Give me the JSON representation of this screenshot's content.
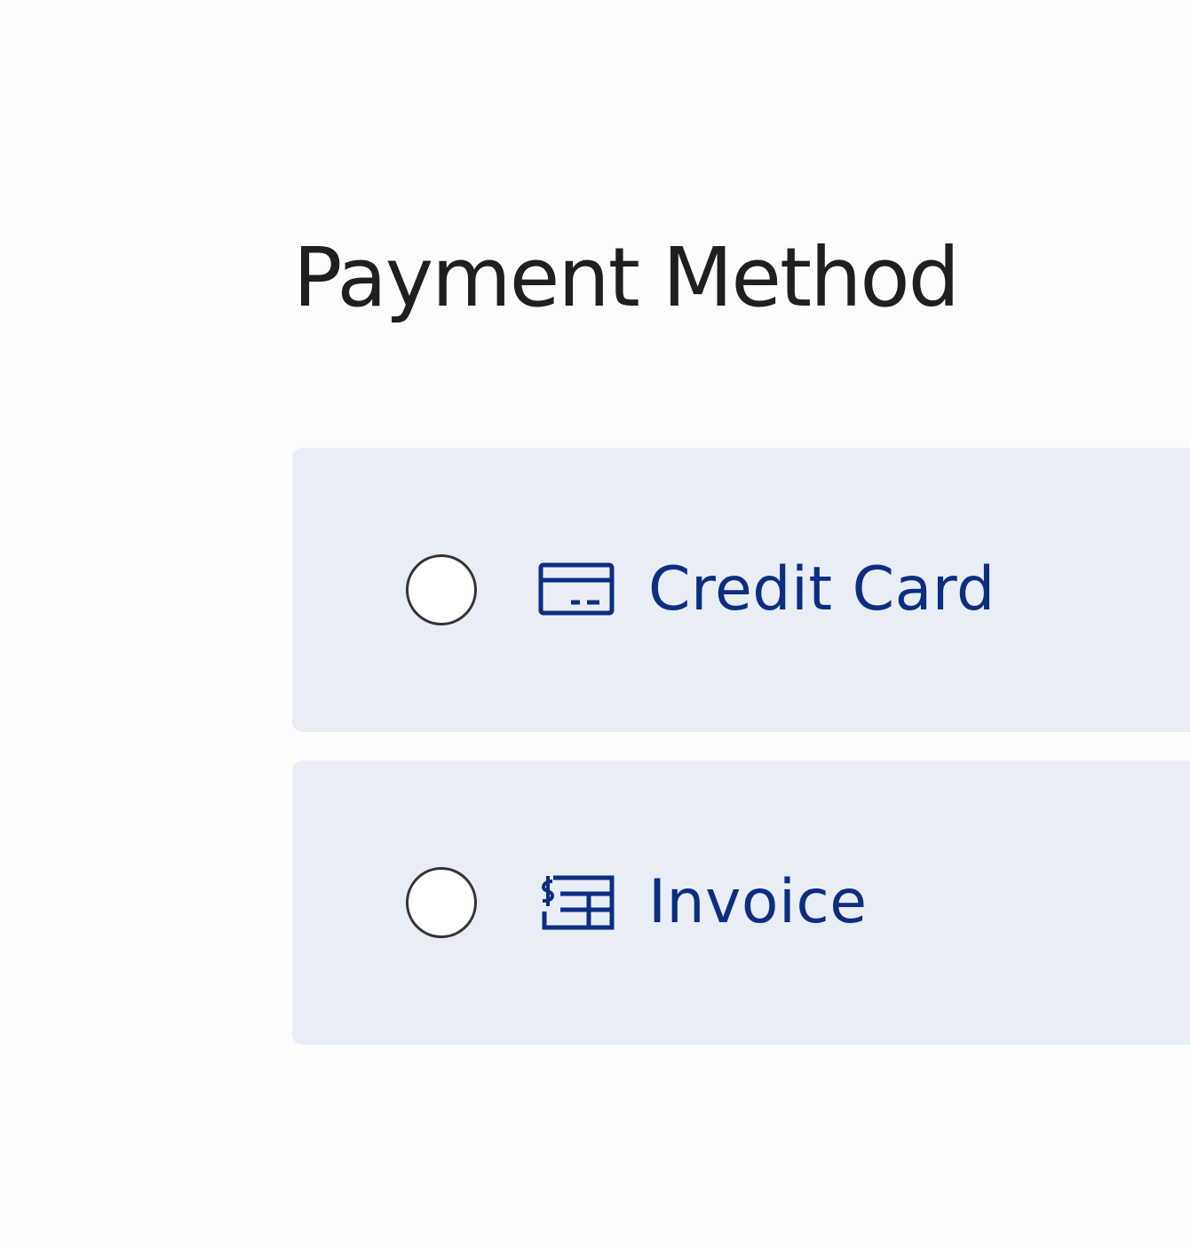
{
  "page": {
    "title": "Payment Method"
  },
  "payment_options": [
    {
      "label": "Credit Card",
      "icon": "credit-card-icon",
      "selected": false
    },
    {
      "label": "Invoice",
      "icon": "invoice-icon",
      "selected": false
    }
  ],
  "colors": {
    "accent": "#0b2e82",
    "option_background": "#e9eef6",
    "title_text": "#1f1f1f",
    "radio_border": "#333333"
  }
}
